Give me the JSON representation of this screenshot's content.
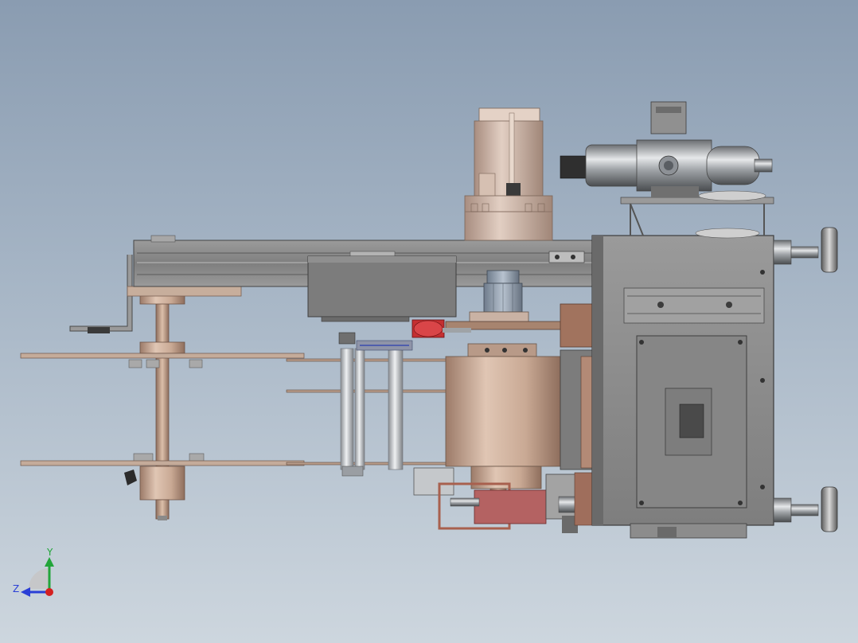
{
  "viewport": {
    "background_top": "#8a9cb1",
    "background_bottom": "#cdd6de"
  },
  "triad": {
    "y_label": "Y",
    "z_label": "Z",
    "y_color": "#22a53a",
    "z_color": "#2a3fd6",
    "x_color": "#d42020"
  },
  "colors": {
    "steel_gray": "#7d7d7d",
    "housing_gray": "#8e8e8e",
    "dark_gray": "#5a5a5a",
    "tan": "#c9a994",
    "tan_dark": "#a8836f",
    "red": "#b8292e",
    "rust": "#a8604e",
    "chrome": "#c0c4c8"
  }
}
